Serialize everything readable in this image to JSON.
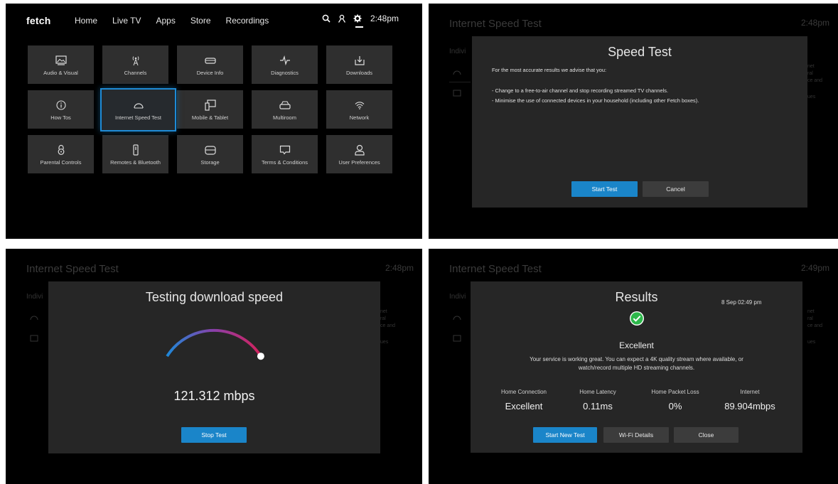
{
  "panel1": {
    "logo": "fetch",
    "nav": [
      "Home",
      "Live TV",
      "Apps",
      "Store",
      "Recordings"
    ],
    "clock": "2:48pm",
    "icons": [
      "search-icon",
      "profile-icon",
      "gear-icon"
    ],
    "tiles": [
      {
        "label": "Audio & Visual",
        "icon": "image-icon"
      },
      {
        "label": "Channels",
        "icon": "antenna-icon"
      },
      {
        "label": "Device Info",
        "icon": "set-top-box-icon"
      },
      {
        "label": "Diagnostics",
        "icon": "pulse-icon"
      },
      {
        "label": "Downloads",
        "icon": "download-icon"
      },
      {
        "label": "How Tos",
        "icon": "info-icon"
      },
      {
        "label": "Internet Speed Test",
        "icon": "speedometer-icon",
        "selected": true
      },
      {
        "label": "Mobile & Tablet",
        "icon": "devices-icon"
      },
      {
        "label": "Multiroom",
        "icon": "multiroom-icon"
      },
      {
        "label": "Network",
        "icon": "wifi-icon"
      },
      {
        "label": "Parental Controls",
        "icon": "lock-icon"
      },
      {
        "label": "Remotes & Bluetooth",
        "icon": "remote-icon"
      },
      {
        "label": "Storage",
        "icon": "storage-icon"
      },
      {
        "label": "Terms & Conditions",
        "icon": "message-icon"
      },
      {
        "label": "User Preferences",
        "icon": "user-icon"
      }
    ]
  },
  "panel2": {
    "bg_title": "Internet Speed Test",
    "bg_clock": "2:48pm",
    "bg_indiv": "Indivi",
    "bg_right": [
      "net",
      "ral",
      "ce and",
      "ues"
    ],
    "modal_title": "Speed Test",
    "intro": "For the most accurate results we advise that you:",
    "tips": [
      "- Change to a free-to-air channel and stop recording streamed TV channels.",
      "- Minimise the use of connected devices in your household (including other Fetch boxes)."
    ],
    "start_button": "Start Test",
    "cancel_button": "Cancel"
  },
  "panel3": {
    "bg_title": "Internet Speed Test",
    "bg_clock": "2:48pm",
    "bg_indiv": "Indivi",
    "bg_right": [
      "net",
      "ral",
      "ce and",
      "ues"
    ],
    "modal_title": "Testing download speed",
    "speed": "121.312 mbps",
    "gauge_progress": 1.0,
    "stop_button": "Stop Test"
  },
  "panel4": {
    "bg_title": "Internet Speed Test",
    "bg_clock": "2:49pm",
    "bg_indiv": "Indivi",
    "bg_right": [
      "net",
      "ral",
      "ce and",
      "ues"
    ],
    "modal_title": "Results",
    "date": "8 Sep 02:49 pm",
    "rating": "Excellent",
    "desc_line1": "Your service is working great. You can expect a 4K quality stream where available, or",
    "desc_line2": "watch/record multiple HD streaming channels.",
    "stats": [
      {
        "label": "Home Connection",
        "value": "Excellent"
      },
      {
        "label": "Home Latency",
        "value": "0.11ms"
      },
      {
        "label": "Home Packet Loss",
        "value": "0%"
      },
      {
        "label": "Internet",
        "value": "89.904mbps"
      }
    ],
    "buttons": [
      "Start New Test",
      "Wi-Fi Details",
      "Close"
    ],
    "colors": {
      "accent": "#1a85c9",
      "success": "#2db84b"
    }
  }
}
